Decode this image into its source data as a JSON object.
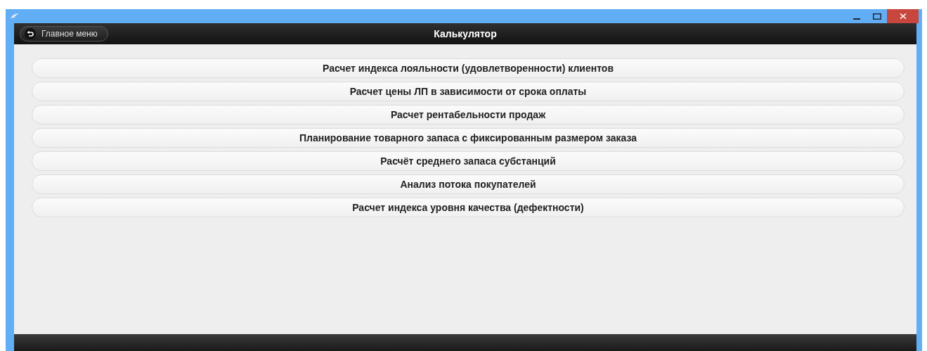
{
  "header": {
    "back_button": "Главное меню",
    "title": "Калькулятор"
  },
  "menu": [
    {
      "label": "Расчет индекса лояльности (удовлетворенности) клиентов"
    },
    {
      "label": "Расчет цены ЛП в зависимости от срока оплаты"
    },
    {
      "label": "Расчет рентабельности продаж"
    },
    {
      "label": "Планирование товарного запаса с фиксированным размером заказа"
    },
    {
      "label": "Расчёт среднего запаса субстанций"
    },
    {
      "label": "Анализ потока покупателей"
    },
    {
      "label": "Расчет индекса уровня качества (дефектности)"
    }
  ]
}
